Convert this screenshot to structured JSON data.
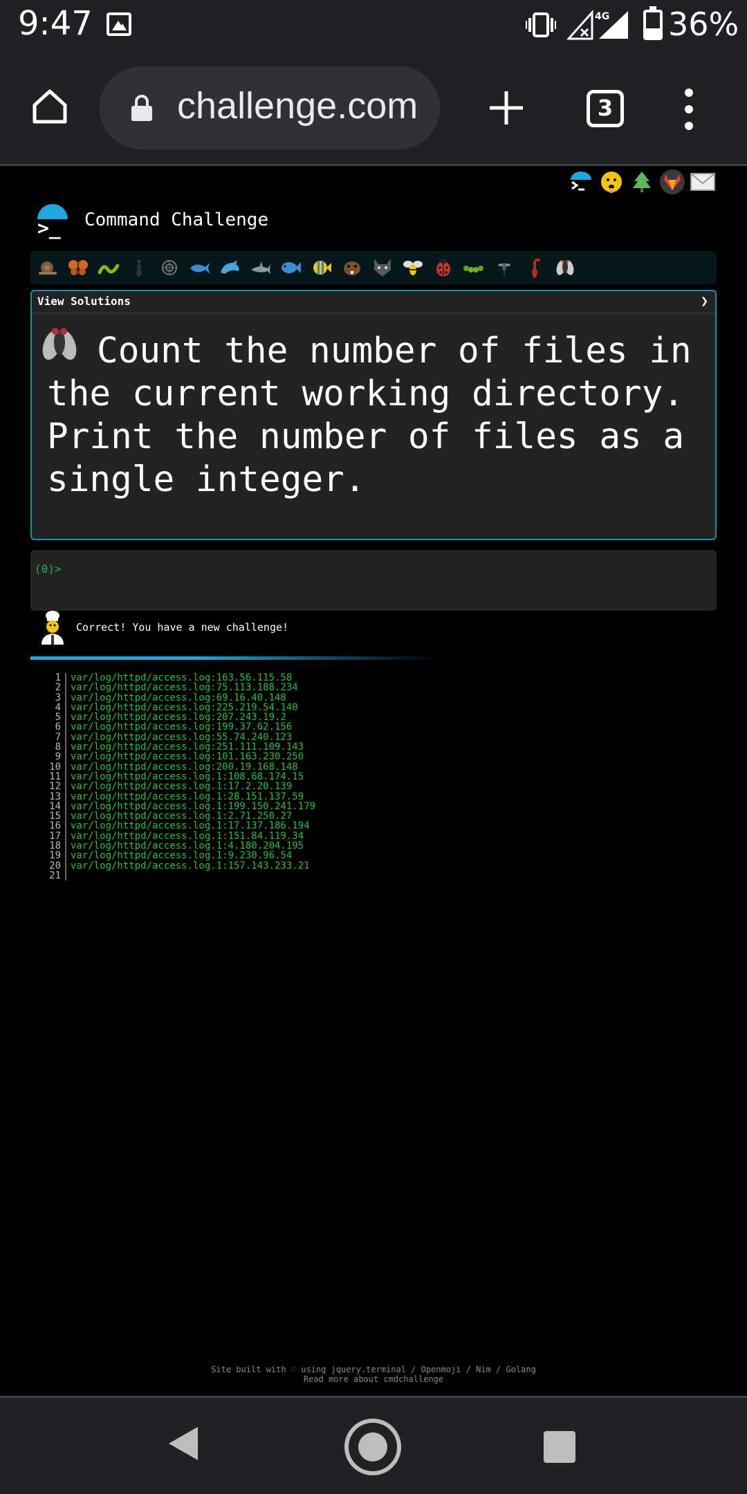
{
  "status_bar": {
    "time": "9:47",
    "network": "4G",
    "battery_percent": "36%",
    "battery_level": 0.36
  },
  "browser": {
    "url": "challenge.com",
    "tab_count": "3"
  },
  "site": {
    "title": "Command Challenge",
    "top_icons": [
      "cmd-icon",
      "hint-face-icon",
      "tree-icon",
      "gitlab-icon",
      "mail-icon"
    ],
    "animals": [
      "snail",
      "butterfly",
      "worm",
      "ant",
      "spider",
      "whale",
      "dolphin",
      "shark",
      "fish",
      "tropical-fish",
      "beaver",
      "wolf",
      "bee",
      "ladybug",
      "caterpillar",
      "mosquito",
      "scorpion",
      "fly"
    ],
    "view_solutions_label": "View Solutions",
    "view_solutions_chevron": "❯",
    "challenge_text": "Count the number of files in the current working directory. Print the number of files as a single integer.",
    "terminal_prompt": "(0)>",
    "message": "Correct! You have a new challenge!",
    "output_lines": [
      {
        "n": "1",
        "text": "var/log/httpd/access.log:163.56.115.58"
      },
      {
        "n": "2",
        "text": "var/log/httpd/access.log:75.113.188.234"
      },
      {
        "n": "3",
        "text": "var/log/httpd/access.log:69.16.40.148"
      },
      {
        "n": "4",
        "text": "var/log/httpd/access.log:225.219.54.140"
      },
      {
        "n": "5",
        "text": "var/log/httpd/access.log:207.243.19.2"
      },
      {
        "n": "6",
        "text": "var/log/httpd/access.log:199.37.62.156"
      },
      {
        "n": "7",
        "text": "var/log/httpd/access.log:55.74.240.123"
      },
      {
        "n": "8",
        "text": "var/log/httpd/access.log:251.111.109.143"
      },
      {
        "n": "9",
        "text": "var/log/httpd/access.log:101.163.230.250"
      },
      {
        "n": "10",
        "text": "var/log/httpd/access.log:200.19.168.148"
      },
      {
        "n": "11",
        "text": "var/log/httpd/access.log.1:108.68.174.15"
      },
      {
        "n": "12",
        "text": "var/log/httpd/access.log.1:17.2.20.139"
      },
      {
        "n": "13",
        "text": "var/log/httpd/access.log.1:28.151.137.59"
      },
      {
        "n": "14",
        "text": "var/log/httpd/access.log.1:199.150.241.179"
      },
      {
        "n": "15",
        "text": "var/log/httpd/access.log.1:2.71.250.27"
      },
      {
        "n": "16",
        "text": "var/log/httpd/access.log.1:17.137.186.194"
      },
      {
        "n": "17",
        "text": "var/log/httpd/access.log.1:151.84.119.34"
      },
      {
        "n": "18",
        "text": "var/log/httpd/access.log.1:4.180.204.195"
      },
      {
        "n": "19",
        "text": "var/log/httpd/access.log.1:9.230.96.54"
      },
      {
        "n": "20",
        "text": "var/log/httpd/access.log.1:157.143.233.21"
      },
      {
        "n": "21",
        "text": ""
      }
    ],
    "footer_line1": "Site built with ♡ using jquery.terminal / Openmoji / Nim / Golang",
    "footer_line2": "Read more about cmdchallenge"
  },
  "colors": {
    "accent": "#1ea7e1",
    "terminal_green": "#22c23a",
    "card_border": "#1a8fb0"
  }
}
